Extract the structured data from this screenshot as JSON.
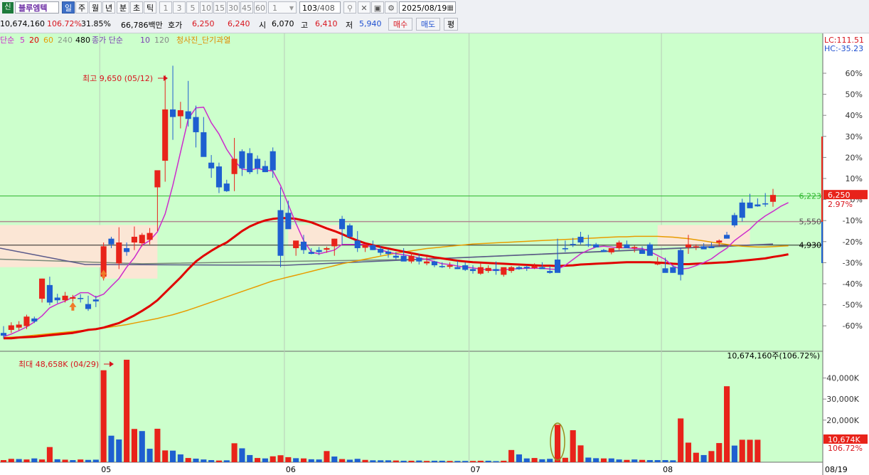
{
  "toolbar": {
    "market_badge": "신",
    "stock_name": "블루엠텍",
    "periods": [
      "일",
      "주",
      "월",
      "년",
      "분",
      "초",
      "틱"
    ],
    "selected_period": "일",
    "intervals": [
      "1",
      "3",
      "5",
      "10",
      "15",
      "30",
      "45",
      "60"
    ],
    "interval_select": "1",
    "count": "103",
    "count_total": "/408",
    "date": "2025/08/19"
  },
  "quote": {
    "volume": "10,674,160",
    "volume_ratio": "106.72%",
    "turnover": "31.85%",
    "amount": "66,786백만",
    "hoga_label": "호가",
    "ask": "6,250",
    "bid": "6,240",
    "open_label": "시",
    "open": "6,070",
    "high_label": "고",
    "high": "6,410",
    "low_label": "저",
    "low": "5,940",
    "buy_label": "매수",
    "sell_label": "매도",
    "eval_label": "평"
  },
  "legend": {
    "ma_prefix": "단순",
    "ma_periods": [
      "5",
      "20",
      "60",
      "240",
      "480"
    ],
    "vol_ma_label": "종가 단순",
    "vol_ma_periods": [
      "10",
      "120"
    ],
    "signal_label": "청사진_단기과열",
    "colors": {
      "ma5": "#cc2bcc",
      "ma20": "#e00000",
      "ma60": "#e89c00",
      "ma240": "#7a8a7a",
      "ma480": "#000000",
      "vol": "#7b3fb3"
    }
  },
  "right_top": {
    "lc": "LC:111.51",
    "hc": "HC:-35.23"
  },
  "colors": {
    "up": "#e8231a",
    "down": "#1e5fd0",
    "bg": "#ccffcc",
    "box": "#fbe6d5",
    "ma20": "#e00000",
    "ma5": "#cc2bcc",
    "ma60": "#e89c00",
    "ma240": "#7a8a7a",
    "ma480": "#555577"
  },
  "annotations": {
    "price_high": "최고 9,650 (05/12)",
    "volume_max": "최대 48,658K (04/29)",
    "volume_current": "10,674,160주(106.72%)"
  },
  "chart_data": [
    {
      "type": "candlestick",
      "title": "",
      "x_labels": [
        "05",
        "06",
        "07",
        "08",
        "08/19"
      ],
      "price_axis_labels": [
        "6,223",
        "5,550",
        "4,930"
      ],
      "pct_axis": [
        "60%",
        "50%",
        "40%",
        "30%",
        "20%",
        "10%",
        "0%",
        "-10%",
        "-20%",
        "-30%",
        "-40%",
        "-50%",
        "-60%"
      ],
      "last_price": "6,250",
      "last_change": "2.97%",
      "ylim": [
        2250,
        10200
      ],
      "ohlc": [
        [
          2620,
          2800,
          2480,
          2550
        ],
        [
          2700,
          2900,
          2620,
          2820
        ],
        [
          2760,
          2930,
          2690,
          2840
        ],
        [
          2800,
          3100,
          2720,
          3050
        ],
        [
          3000,
          3050,
          2880,
          2920
        ],
        [
          3520,
          4050,
          3420,
          4050
        ],
        [
          3880,
          4100,
          3350,
          3420
        ],
        [
          3550,
          3650,
          3400,
          3480
        ],
        [
          3480,
          3700,
          3420,
          3600
        ],
        [
          3520,
          3620,
          3440,
          3560
        ],
        [
          3540,
          3640,
          3420,
          3520
        ],
        [
          3380,
          3600,
          3200,
          3250
        ],
        [
          3500,
          3600,
          3300,
          3450
        ],
        [
          4100,
          5000,
          4000,
          4900
        ],
        [
          5100,
          5150,
          4850,
          4950
        ],
        [
          4450,
          5400,
          4300,
          5000
        ],
        [
          4850,
          5000,
          4650,
          4750
        ],
        [
          5000,
          5420,
          4800,
          5150
        ],
        [
          4980,
          5250,
          4900,
          5200
        ],
        [
          5070,
          5380,
          4950,
          5250
        ],
        [
          6450,
          6450,
          5300,
          6900
        ],
        [
          7150,
          9400,
          6600,
          8500
        ],
        [
          8500,
          9650,
          7700,
          8300
        ],
        [
          8320,
          8700,
          8000,
          8480
        ],
        [
          8450,
          9250,
          8050,
          8250
        ],
        [
          8300,
          8600,
          7500,
          7900
        ],
        [
          7900,
          8300,
          7300,
          7250
        ],
        [
          7100,
          7300,
          6700,
          6950
        ],
        [
          7000,
          7100,
          6300,
          6450
        ],
        [
          6550,
          6650,
          6330,
          6350
        ],
        [
          6800,
          7750,
          6350,
          7200
        ],
        [
          7400,
          7450,
          6750,
          6950
        ],
        [
          7350,
          7480,
          6800,
          6850
        ],
        [
          7200,
          7290,
          6800,
          6950
        ],
        [
          7010,
          7150,
          6850,
          6850
        ],
        [
          7400,
          7500,
          6700,
          6900
        ],
        [
          5850,
          6450,
          4350,
          4650
        ],
        [
          5780,
          6100,
          5450,
          5350
        ],
        [
          4850,
          4960,
          4650,
          5050
        ],
        [
          5020,
          5200,
          4700,
          4800
        ],
        [
          4750,
          4850,
          4690,
          4700
        ],
        [
          4800,
          4880,
          4670,
          4750
        ],
        [
          4810,
          4890,
          4730,
          4850
        ],
        [
          4900,
          5100,
          4650,
          5100
        ],
        [
          5620,
          5700,
          4950,
          5350
        ],
        [
          5450,
          5500,
          5100,
          5150
        ],
        [
          5050,
          5300,
          4750,
          4850
        ],
        [
          4860,
          4950,
          4750,
          4950
        ],
        [
          4930,
          5050,
          4800,
          4800
        ],
        [
          4830,
          4900,
          4660,
          4730
        ],
        [
          4760,
          4830,
          4600,
          4700
        ],
        [
          4650,
          4750,
          4550,
          4600
        ],
        [
          4650,
          4850,
          4520,
          4500
        ],
        [
          4500,
          4730,
          4450,
          4650
        ],
        [
          4600,
          4700,
          4420,
          4500
        ],
        [
          4450,
          4650,
          4400,
          4500
        ],
        [
          4500,
          4520,
          4350,
          4400
        ],
        [
          4380,
          4480,
          4330,
          4350
        ],
        [
          4360,
          4480,
          4310,
          4400
        ],
        [
          4350,
          4520,
          4300,
          4300
        ],
        [
          4400,
          4480,
          4250,
          4280
        ],
        [
          4300,
          4400,
          4180,
          4250
        ],
        [
          4180,
          4450,
          4150,
          4350
        ],
        [
          4250,
          4400,
          4200,
          4330
        ],
        [
          4300,
          4500,
          4150,
          4250
        ],
        [
          4150,
          4330,
          4100,
          4350
        ],
        [
          4250,
          4380,
          4200,
          4350
        ],
        [
          4350,
          4380,
          4280,
          4300
        ],
        [
          4360,
          4400,
          4250,
          4320
        ],
        [
          4330,
          4450,
          4300,
          4380
        ],
        [
          4350,
          4480,
          4320,
          4300
        ],
        [
          4250,
          4380,
          4180,
          4200
        ],
        [
          4550,
          5100,
          4480,
          4200
        ],
        [
          4850,
          5050,
          4750,
          4820
        ],
        [
          4960,
          5120,
          4880,
          4950
        ],
        [
          5150,
          5280,
          4950,
          5000
        ],
        [
          4950,
          5200,
          4880,
          4930
        ],
        [
          4950,
          4990,
          4880,
          4870
        ],
        [
          4800,
          4830,
          4750,
          4750
        ],
        [
          4740,
          4850,
          4690,
          4850
        ],
        [
          4850,
          5050,
          4800,
          5000
        ],
        [
          4950,
          5050,
          4850,
          4850
        ],
        [
          4850,
          4920,
          4740,
          4880
        ],
        [
          4800,
          4900,
          4720,
          4700
        ],
        [
          4950,
          5000,
          4680,
          4650
        ],
        [
          4440,
          4620,
          4400,
          4450
        ],
        [
          4320,
          4600,
          4250,
          4200
        ],
        [
          4350,
          4400,
          4200,
          4200
        ],
        [
          4800,
          4850,
          4000,
          4150
        ],
        [
          4870,
          5200,
          4700,
          4950
        ],
        [
          4880,
          4950,
          4800,
          4900
        ],
        [
          4900,
          4980,
          4850,
          4820
        ],
        [
          4900,
          5000,
          4850,
          4850
        ],
        [
          5000,
          5080,
          4900,
          5050
        ],
        [
          5200,
          5280,
          5100,
          5100
        ],
        [
          5720,
          5780,
          5400,
          5450
        ],
        [
          6050,
          6150,
          5550,
          5650
        ],
        [
          6050,
          6280,
          5950,
          5900
        ],
        [
          6000,
          6160,
          5940,
          5950
        ],
        [
          6030,
          6300,
          5940,
          6000
        ],
        [
          6070,
          6410,
          5940,
          6250
        ]
      ],
      "ma5": [
        2520,
        2590,
        2680,
        2780,
        2910,
        3070,
        3280,
        3380,
        3460,
        3560,
        3680,
        3680,
        3560,
        3640,
        3850,
        4050,
        4350,
        4600,
        4930,
        5050,
        5280,
        5750,
        6500,
        7380,
        8250,
        8540,
        8560,
        8150,
        7850,
        7450,
        7150,
        6930,
        6900,
        6950,
        6900,
        6880,
        6500,
        6000,
        5500,
        5050,
        4750,
        4700,
        4750,
        4800,
        4950,
        4950,
        4950,
        4950,
        4850,
        4800,
        4750,
        4700,
        4680,
        4640,
        4590,
        4550,
        4500,
        4440,
        4420,
        4380,
        4350,
        4330,
        4300,
        4280,
        4270,
        4280,
        4300,
        4310,
        4320,
        4320,
        4320,
        4300,
        4290,
        4400,
        4550,
        4700,
        4800,
        4880,
        4900,
        4880,
        4860,
        4860,
        4840,
        4840,
        4760,
        4660,
        4550,
        4380,
        4300,
        4320,
        4390,
        4470,
        4570,
        4720,
        4850,
        5050,
        5200,
        5350,
        5550,
        5700,
        5820,
        5950,
        6050
      ],
      "ma20": [
        2480,
        2480,
        2500,
        2510,
        2520,
        2540,
        2560,
        2580,
        2600,
        2620,
        2660,
        2700,
        2720,
        2760,
        2820,
        2880,
        2980,
        3080,
        3200,
        3330,
        3480,
        3680,
        3880,
        4080,
        4300,
        4500,
        4650,
        4780,
        4900,
        5000,
        5150,
        5300,
        5420,
        5510,
        5580,
        5620,
        5640,
        5640,
        5620,
        5580,
        5530,
        5450,
        5370,
        5300,
        5220,
        5130,
        5050,
        4980,
        4930,
        4880,
        4840,
        4800,
        4760,
        4720,
        4680,
        4650,
        4610,
        4580,
        4550,
        4520,
        4500,
        4480,
        4470,
        4460,
        4450,
        4440,
        4430,
        4420,
        4410,
        4400,
        4390,
        4390,
        4380,
        4390,
        4400,
        4420,
        4430,
        4440,
        4450,
        4460,
        4470,
        4480,
        4480,
        4480,
        4480,
        4470,
        4460,
        4440,
        4430,
        4430,
        4440,
        4450,
        4460,
        4470,
        4480,
        4500,
        4520,
        4540,
        4560,
        4580,
        4620,
        4650,
        4690
      ],
      "ma60": [
        2500,
        2510,
        2520,
        2540,
        2560,
        2580,
        2600,
        2620,
        2640,
        2660,
        2680,
        2700,
        2720,
        2750,
        2780,
        2810,
        2840,
        2880,
        2920,
        2960,
        3000,
        3050,
        3100,
        3160,
        3220,
        3290,
        3360,
        3430,
        3500,
        3570,
        3640,
        3710,
        3780,
        3850,
        3920,
        3990,
        4040,
        4090,
        4140,
        4190,
        4240,
        4290,
        4340,
        4390,
        4440,
        4480,
        4520,
        4560,
        4600,
        4640,
        4680,
        4720,
        4750,
        4780,
        4810,
        4840,
        4860,
        4880,
        4900,
        4920,
        4940,
        4960,
        4970,
        4980,
        4990,
        5000,
        5010,
        5020,
        5030,
        5040,
        5050,
        5060,
        5070,
        5080,
        5090,
        5100,
        5110,
        5120,
        5130,
        5140,
        5150,
        5150,
        5160,
        5160,
        5160,
        5160,
        5150,
        5140,
        5120,
        5100,
        5070,
        5040,
        5010,
        4980,
        4950,
        4920,
        4900,
        4890,
        4880,
        4880,
        4890,
        4900,
        4910
      ]
    },
    {
      "type": "bar",
      "title": "",
      "series_name": "거래량",
      "unit": "K",
      "y_axis_labels": [
        "40,000K",
        "30,000K",
        "20,000K"
      ],
      "current_label": "10,674K",
      "current_pct": "106.72%",
      "ylim": [
        0,
        49000
      ],
      "values": [
        1000,
        1600,
        1500,
        1300,
        1800,
        1300,
        7200,
        1400,
        1200,
        1000,
        1300,
        1100,
        1200,
        43700,
        12600,
        10800,
        48700,
        15800,
        14800,
        6400,
        15900,
        5600,
        5500,
        3700,
        2000,
        1700,
        1300,
        1000,
        800,
        900,
        9000,
        6600,
        3400,
        2000,
        1800,
        2800,
        3300,
        2400,
        1900,
        1800,
        1400,
        1300,
        5300,
        2700,
        1500,
        1200,
        1600,
        1100,
        900,
        900,
        900,
        800,
        700,
        700,
        800,
        600,
        700,
        700,
        600,
        600,
        600,
        600,
        700,
        700,
        500,
        700,
        5800,
        3700,
        1800,
        2000,
        1400,
        1600,
        17800,
        2100,
        15200,
        8000,
        2200,
        1900,
        1800,
        1800,
        1300,
        1100,
        1300,
        1100,
        1000,
        1000,
        1000,
        900,
        20800,
        9300,
        4500,
        3400,
        5300,
        9100,
        36100,
        7900,
        10674,
        10674,
        10674
      ],
      "up": [
        true,
        true,
        false,
        true,
        false,
        true,
        true,
        false,
        true,
        false,
        true,
        false,
        false,
        true,
        false,
        false,
        true,
        true,
        false,
        false,
        true,
        true,
        false,
        false,
        true,
        false,
        false,
        false,
        true,
        false,
        true,
        false,
        false,
        true,
        false,
        true,
        true,
        true,
        false,
        true,
        false,
        false,
        true,
        false,
        true,
        false,
        false,
        true,
        false,
        false,
        false,
        true,
        false,
        true,
        false,
        true,
        false,
        false,
        true,
        false,
        false,
        true,
        true,
        false,
        false,
        true,
        true,
        false,
        false,
        true,
        false,
        false,
        true,
        true,
        true,
        true,
        false,
        false,
        true,
        false,
        false,
        true,
        false,
        true,
        false,
        false,
        false,
        false,
        true,
        true,
        true,
        false,
        true,
        true,
        true,
        false,
        true,
        true,
        true
      ]
    }
  ]
}
